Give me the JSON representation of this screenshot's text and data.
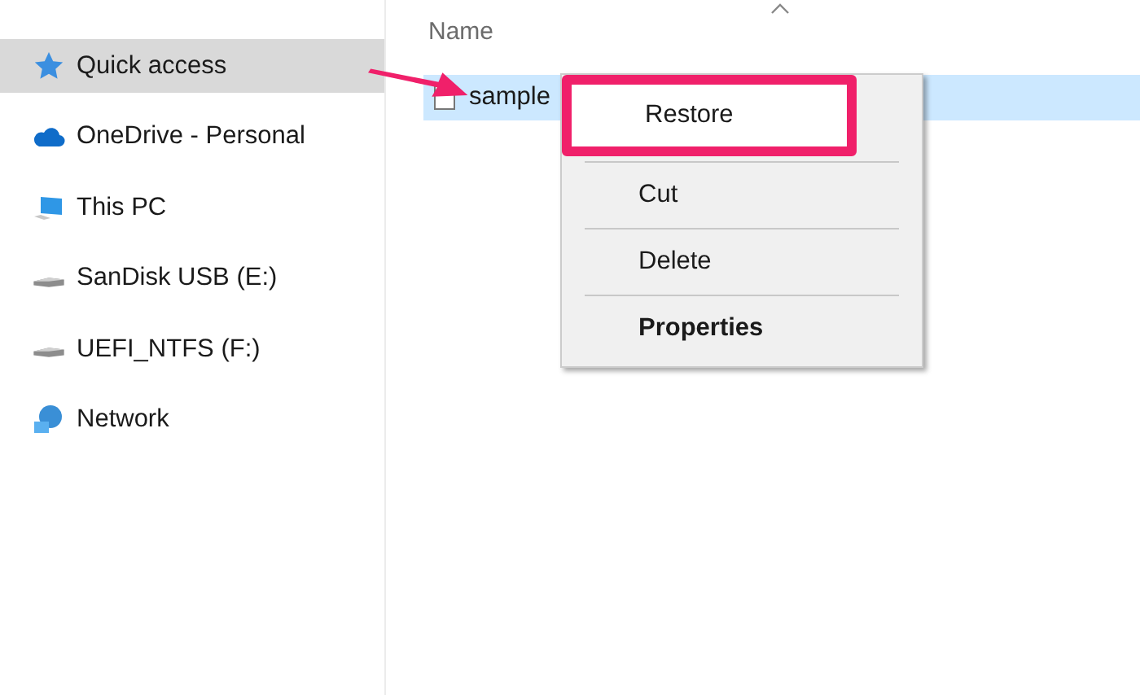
{
  "sidebar": {
    "items": [
      {
        "label": "Quick access",
        "kind": "star",
        "selected": true
      },
      {
        "label": "OneDrive - Personal",
        "kind": "cloud",
        "selected": false
      },
      {
        "label": "This PC",
        "kind": "pc",
        "selected": false
      },
      {
        "label": "SanDisk USB (E:)",
        "kind": "drive",
        "selected": false
      },
      {
        "label": "UEFI_NTFS (F:)",
        "kind": "drive",
        "selected": false
      },
      {
        "label": "Network",
        "kind": "network",
        "selected": false
      }
    ]
  },
  "file_list": {
    "columns": [
      {
        "label": "Name",
        "sorted": true
      }
    ],
    "rows": [
      {
        "name": "sample",
        "selected": true
      }
    ]
  },
  "context_menu": {
    "items": [
      {
        "label": "Restore",
        "bold": false,
        "annotated": true
      },
      {
        "label": "Cut",
        "bold": false,
        "annotated": false
      },
      {
        "label": "Delete",
        "bold": false,
        "annotated": false
      },
      {
        "label": "Properties",
        "bold": true,
        "annotated": false
      }
    ]
  },
  "annotation": {
    "arrow": true
  }
}
